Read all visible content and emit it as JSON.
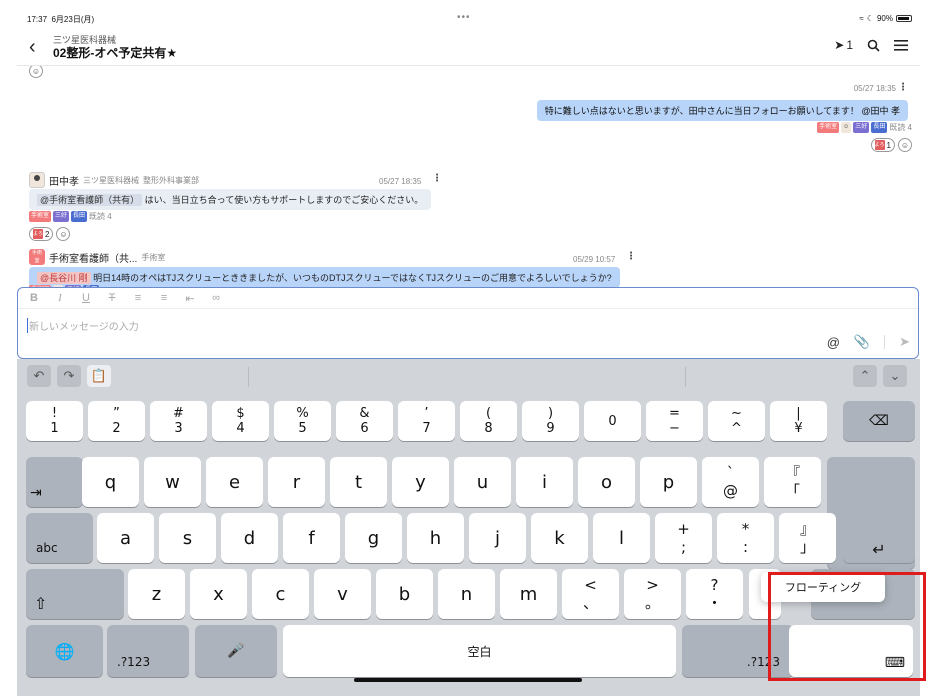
{
  "status": {
    "time": "17:37",
    "date": "6月23日(月)",
    "dots": "•••",
    "battery": "90%"
  },
  "header": {
    "org": "三ツ星医科器械",
    "channel": "02整形-オペ予定共有★",
    "pin_count": "1"
  },
  "messages": {
    "m1": {
      "time": "05/27 18:35",
      "text": "特に難しい点はないと思いますが、田中さんに当日フォローお願いしてます！ @田中 孝",
      "read": "既読 4",
      "stamp_count": "1"
    },
    "m2": {
      "name": "田中孝",
      "org": "三ツ星医科器械",
      "dept": "整形外科事業部",
      "time": "05/27 18:35",
      "mention": "@手術室看護師（共有）",
      "text": "はい、当日立ち合って使い方もサポートしますのでご安心ください。",
      "read": "既読 4",
      "stamp_count": "2"
    },
    "m3": {
      "name": "手術室看護師（共...",
      "dept": "手術室",
      "time": "05/29 10:57",
      "mention": "@長谷川 剛",
      "text": "明日14時のオペはTJスクリューとききましたが、いつものDTJスクリューではなくTJスクリューのご用意でよろしいでしょうか?"
    }
  },
  "editor": {
    "placeholder": "新しいメッセージの入力"
  },
  "keyboard": {
    "row1": [
      {
        "top": "!",
        "bottom": "1"
      },
      {
        "top": "”",
        "bottom": "2"
      },
      {
        "top": "#",
        "bottom": "3"
      },
      {
        "top": "$",
        "bottom": "4"
      },
      {
        "top": "%",
        "bottom": "5"
      },
      {
        "top": "&",
        "bottom": "6"
      },
      {
        "top": "’",
        "bottom": "7"
      },
      {
        "top": "(",
        "bottom": "8"
      },
      {
        "top": ")",
        "bottom": "9"
      },
      {
        "top": "",
        "bottom": "0"
      },
      {
        "top": "=",
        "bottom": "−"
      },
      {
        "top": "~",
        "bottom": "^"
      },
      {
        "top": "|",
        "bottom": "¥"
      }
    ],
    "row2": [
      "q",
      "w",
      "e",
      "r",
      "t",
      "y",
      "u",
      "i",
      "o",
      "p"
    ],
    "row2_extra": [
      {
        "top": "`",
        "bottom": "@"
      },
      {
        "top": "『",
        "bottom": "「"
      }
    ],
    "row3": [
      "a",
      "s",
      "d",
      "f",
      "g",
      "h",
      "j",
      "k",
      "l"
    ],
    "row3_extra": [
      {
        "top": "+",
        "bottom": ";"
      },
      {
        "top": "*",
        "bottom": ":"
      },
      {
        "top": "』",
        "bottom": "」"
      }
    ],
    "row4": [
      "z",
      "x",
      "c",
      "v",
      "b",
      "n",
      "m"
    ],
    "row4_extra": [
      {
        "top": "<",
        "bottom": "、"
      },
      {
        "top": ">",
        "bottom": "。"
      },
      {
        "top": "?",
        "bottom": "・"
      }
    ],
    "abc": "abc",
    "num_left": ".?123",
    "num_right": ".?123",
    "space": "空白"
  },
  "popup": {
    "label": "フローティング"
  },
  "colors": {
    "highlight": "#e01b1b",
    "bubble_self": "#b8d4f8",
    "keyboard_bg": "#d1d4d9"
  }
}
